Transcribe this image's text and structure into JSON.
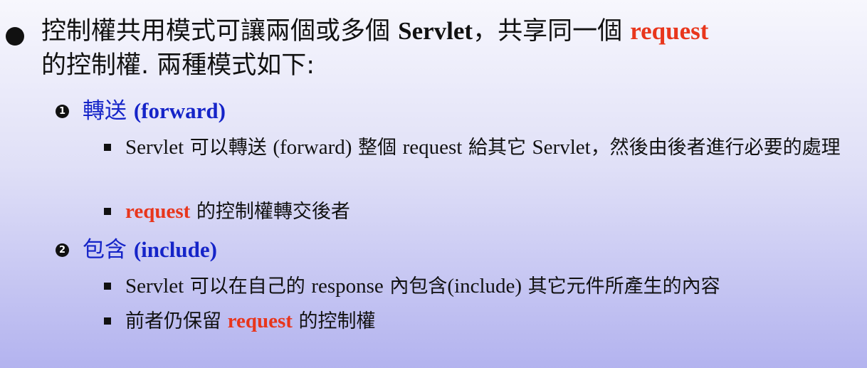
{
  "bullet1": {
    "text_a": "控制權共用模式可讓兩個或多個 ",
    "servlet": "Servlet",
    "text_b": "，共享同一個 ",
    "request": "request",
    "text_c": "的控制權. 兩種模式如下:"
  },
  "forward": {
    "marker": "1",
    "label": "轉送 ",
    "english": "(forward)",
    "items": [
      {
        "servlet": "Servlet",
        "text1": " 可以轉送 ",
        "paren": "(forward)",
        "text2": " 整個 ",
        "request": "request",
        "text3": " 給其它 ",
        "servlet2": "Servlet",
        "text4": "，然後由後者進行必要的處理"
      },
      {
        "request": "request",
        "text": " 的控制權轉交後者"
      }
    ]
  },
  "include": {
    "marker": "2",
    "label": "包含 ",
    "english": "(include)",
    "items": [
      {
        "servlet": "Servlet",
        "text1": " 可以在自己的 ",
        "response": "response",
        "text2": " 內包含",
        "paren": "(include)",
        "text3": " 其它元件所產生的內容"
      },
      {
        "text1": "前者仍保留 ",
        "request": "request",
        "text2": " 的控制權"
      }
    ]
  }
}
